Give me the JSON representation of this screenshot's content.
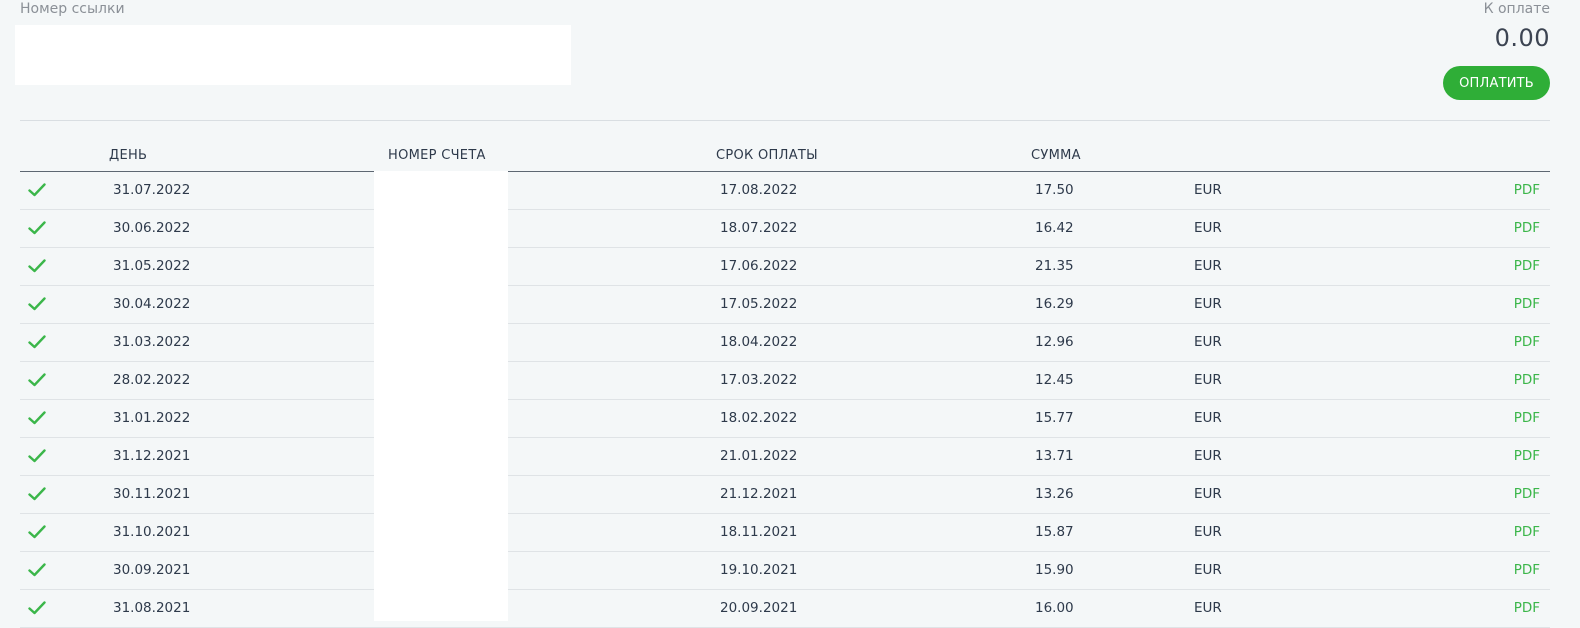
{
  "reference": {
    "label": "Номер ссылки",
    "value": "",
    "placeholder": ""
  },
  "payment": {
    "label": "К оплате",
    "amount": "0.00",
    "button_label": "ОПЛАТИТЬ"
  },
  "table": {
    "headers": {
      "day": "ДЕНЬ",
      "invoice_no": "НОМЕР СЧЕТА",
      "due_date": "СРОК ОПЛАТЫ",
      "amount": "СУММА"
    },
    "rows": [
      {
        "status": "paid",
        "day": "31.07.2022",
        "due": "17.08.2022",
        "amount": "17.50",
        "currency": "EUR",
        "link": "PDF"
      },
      {
        "status": "paid",
        "day": "30.06.2022",
        "due": "18.07.2022",
        "amount": "16.42",
        "currency": "EUR",
        "link": "PDF"
      },
      {
        "status": "paid",
        "day": "31.05.2022",
        "due": "17.06.2022",
        "amount": "21.35",
        "currency": "EUR",
        "link": "PDF"
      },
      {
        "status": "paid",
        "day": "30.04.2022",
        "due": "17.05.2022",
        "amount": "16.29",
        "currency": "EUR",
        "link": "PDF"
      },
      {
        "status": "paid",
        "day": "31.03.2022",
        "due": "18.04.2022",
        "amount": "12.96",
        "currency": "EUR",
        "link": "PDF"
      },
      {
        "status": "paid",
        "day": "28.02.2022",
        "due": "17.03.2022",
        "amount": "12.45",
        "currency": "EUR",
        "link": "PDF"
      },
      {
        "status": "paid",
        "day": "31.01.2022",
        "due": "18.02.2022",
        "amount": "15.77",
        "currency": "EUR",
        "link": "PDF"
      },
      {
        "status": "paid",
        "day": "31.12.2021",
        "due": "21.01.2022",
        "amount": "13.71",
        "currency": "EUR",
        "link": "PDF"
      },
      {
        "status": "paid",
        "day": "30.11.2021",
        "due": "21.12.2021",
        "amount": "13.26",
        "currency": "EUR",
        "link": "PDF"
      },
      {
        "status": "paid",
        "day": "31.10.2021",
        "due": "18.11.2021",
        "amount": "15.87",
        "currency": "EUR",
        "link": "PDF"
      },
      {
        "status": "paid",
        "day": "30.09.2021",
        "due": "19.10.2021",
        "amount": "15.90",
        "currency": "EUR",
        "link": "PDF"
      },
      {
        "status": "paid",
        "day": "31.08.2021",
        "due": "20.09.2021",
        "amount": "16.00",
        "currency": "EUR",
        "link": "PDF"
      }
    ]
  },
  "icons": {
    "status_paid": "checkmark-icon"
  },
  "colors": {
    "accent_green": "#2fae37",
    "check_green": "#3bb64a",
    "text": "#2e3a4b",
    "muted": "#8b9097"
  }
}
